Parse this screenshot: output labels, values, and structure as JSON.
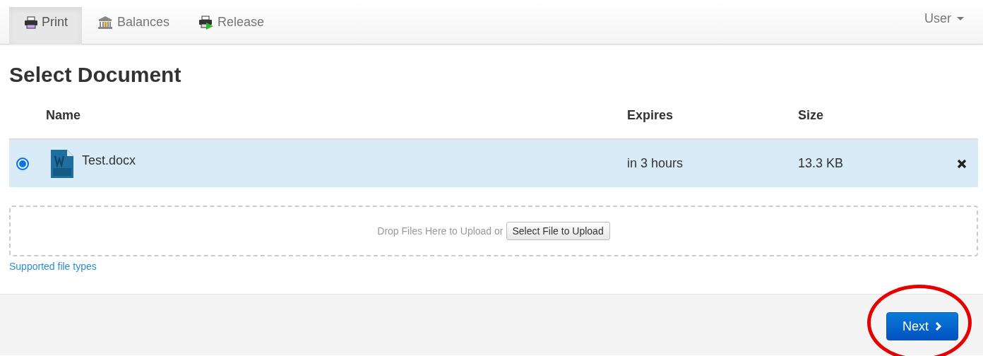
{
  "navbar": {
    "tabs": [
      {
        "label": "Print",
        "kind": "printer",
        "selected": true
      },
      {
        "label": "Balances",
        "kind": "bank",
        "selected": false
      },
      {
        "label": "Release",
        "kind": "release",
        "selected": false
      }
    ],
    "user_menu": {
      "label": "User"
    }
  },
  "title": "Select Document",
  "table": {
    "columns": [
      "Name",
      "Expires",
      "Size"
    ],
    "rows": [
      {
        "selected": true,
        "name": "Test.docx",
        "expires": "in 3 hours",
        "size": "13.3 KB"
      }
    ]
  },
  "upload": {
    "prompt": "Drop Files Here to Upload or",
    "button": "Select File to Upload"
  },
  "supported_link": "Supported file types",
  "next_button": {
    "label": "Next",
    "circled": true
  }
}
